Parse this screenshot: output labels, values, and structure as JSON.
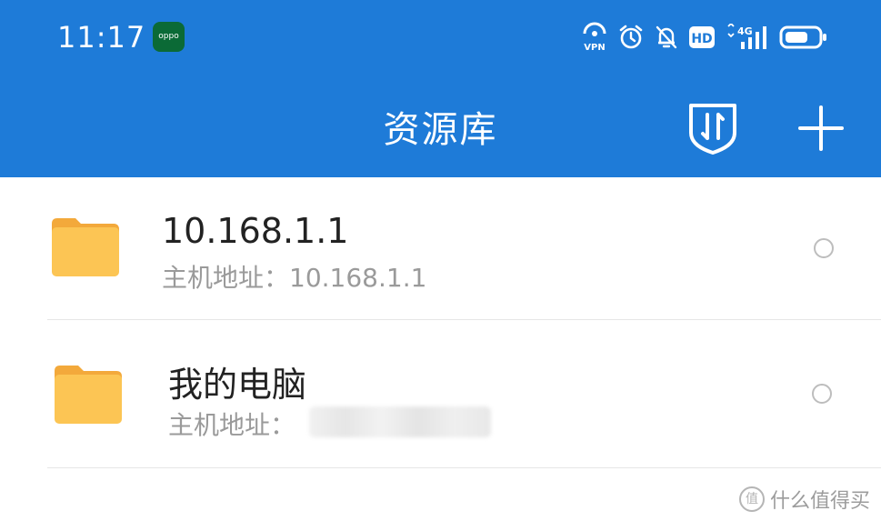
{
  "status_bar": {
    "time": "11:17",
    "app_badge_text": "oppo",
    "icons": [
      "vpn-icon",
      "alarm-icon",
      "bell-off-icon",
      "hd-icon",
      "signal-4g-icon",
      "battery-icon"
    ],
    "vpn_label": "VPN",
    "hd_label": "HD",
    "network_label": "4G"
  },
  "app_bar": {
    "title": "资源库",
    "background_color": "#1e7bd8"
  },
  "list": {
    "items": [
      {
        "title": "10.168.1.1",
        "subtitle": "主机地址：10.168.1.1",
        "icon": "folder-icon",
        "selected": false
      },
      {
        "title": "我的电脑",
        "subtitle": "主机地址：",
        "icon": "folder-icon",
        "selected": false
      }
    ]
  },
  "watermark": {
    "icon_glyph": "值",
    "text": "什么值得买"
  }
}
